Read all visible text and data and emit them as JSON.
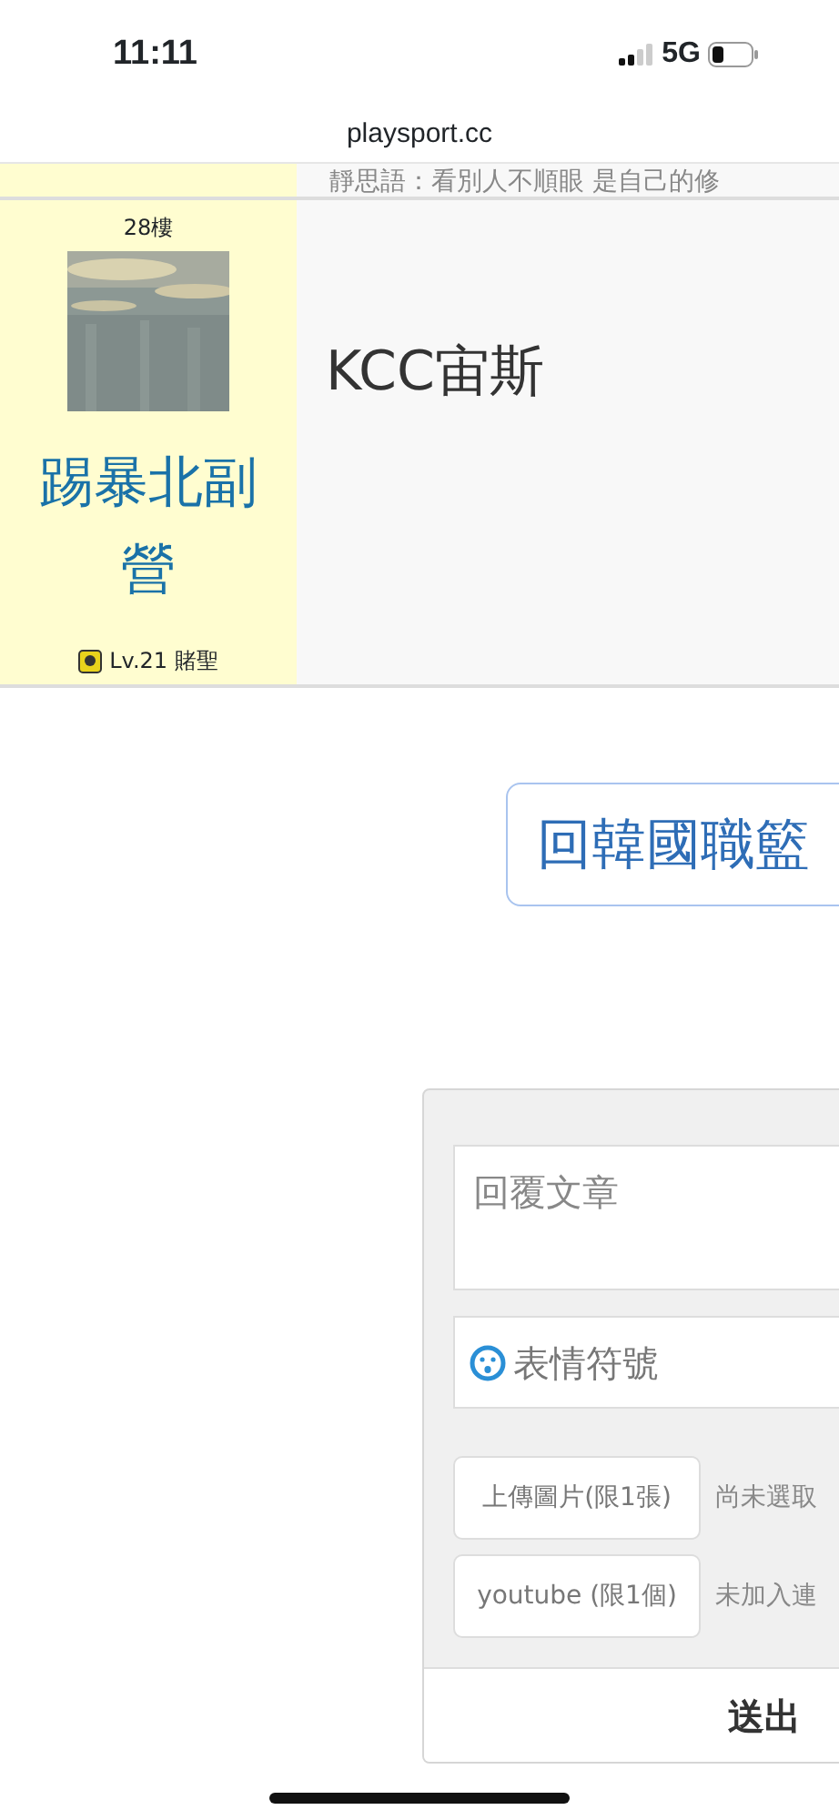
{
  "status_bar": {
    "time": "11:11",
    "network": "5G"
  },
  "address_bar": {
    "url": "playsport.cc"
  },
  "quote": "靜思語：看別人不順眼 是自己的修",
  "post": {
    "floor": "28樓",
    "author": "踢暴北副營",
    "level": "Lv.21 賭聖",
    "title": "KCC宙斯"
  },
  "back_button": {
    "label": "回韓國職籃"
  },
  "reply_form": {
    "message": {
      "placeholder": "回覆文章"
    },
    "emoji_button": "表情符號",
    "attachments": [
      {
        "button": "上傳圖片(限1張)",
        "status": "尚未選取"
      },
      {
        "button": "youtube (限1個)",
        "status": "未加入連"
      }
    ],
    "submit": "送出"
  }
}
